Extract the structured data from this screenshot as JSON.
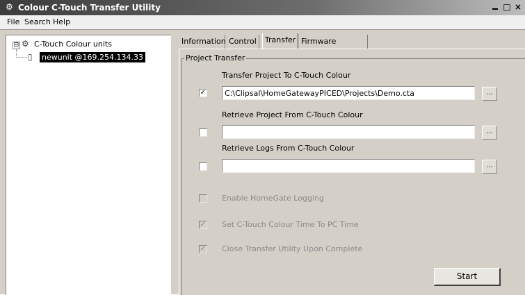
{
  "window": {
    "title": "Colour C-Touch Transfer Utility",
    "icon": "app-icon",
    "controls": {
      "minimize": "_",
      "restore": "□",
      "close": "×"
    }
  },
  "menubar": {
    "items": [
      {
        "label": "File"
      },
      {
        "label": "Search"
      },
      {
        "label": "Help"
      }
    ]
  },
  "tree": {
    "root_label": "C-Touch Colour units",
    "expander": "⊟",
    "child_label": "newunit @169.254.134.33"
  },
  "tabs": [
    {
      "label": "Information"
    },
    {
      "label": "Control"
    },
    {
      "label": "Transfer",
      "active": true
    },
    {
      "label": "Firmware Upgrade"
    }
  ],
  "transfer": {
    "group_title": "Project Transfer",
    "sections": [
      {
        "label": "Transfer Project To C-Touch Colour",
        "checked": true,
        "mark": "✓",
        "path": "C:\\Clipsal\\HomeGatewayPICED\\Projects\\Demo.cta",
        "browse": "..."
      },
      {
        "label": "Retrieve Project From C-Touch Colour",
        "checked": false,
        "mark": "",
        "path": "",
        "browse": "..."
      },
      {
        "label": "Retrieve Logs From C-Touch Colour",
        "checked": false,
        "mark": "",
        "path": "",
        "browse": "..."
      }
    ],
    "options": [
      {
        "label": "Enable HomeGate Logging",
        "checked": false,
        "mark": ""
      },
      {
        "label": "Set C-Touch Colour Time To PC Time",
        "checked": true,
        "mark": "✓"
      },
      {
        "label": "Close Transfer Utility Upon Complete",
        "checked": true,
        "mark": "✓"
      }
    ],
    "start_label": "Start"
  }
}
